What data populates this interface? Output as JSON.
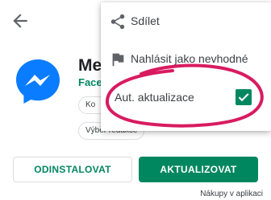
{
  "app": {
    "name": "Mes",
    "developer": "Face"
  },
  "chips": {
    "chip1": "Ko",
    "chip2": "",
    "chip3": "Výběr redakce"
  },
  "buttons": {
    "uninstall": "ODINSTALOVAT",
    "update": "AKTUALIZOVAT"
  },
  "footer": {
    "purchases": "Nákupy v aplikaci"
  },
  "menu": {
    "share": "Sdílet",
    "report": "Nahlásit jako nevhodné",
    "auto_update": "Aut. aktualizace",
    "auto_update_checked": true
  },
  "colors": {
    "accent": "#01875f",
    "messenger": "#0a7cff",
    "annotation": "#d81b60"
  }
}
